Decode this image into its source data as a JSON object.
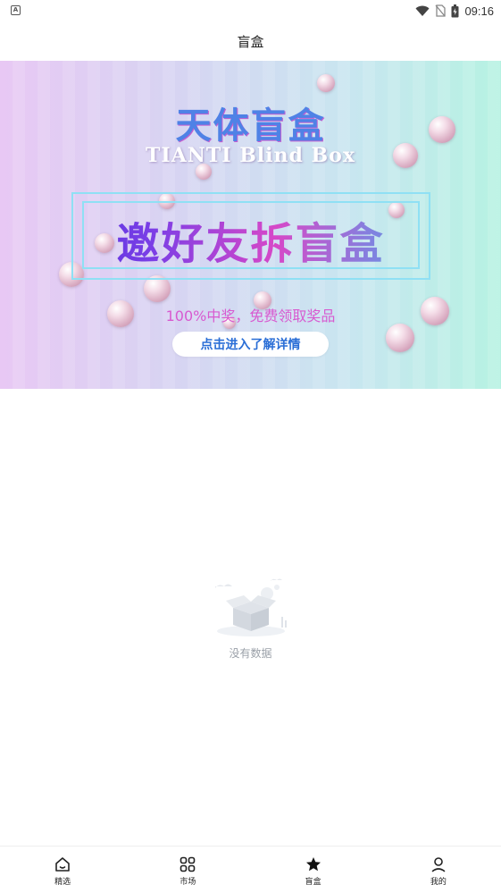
{
  "status_bar": {
    "left_icon_letter": "A",
    "time": "09:16",
    "icons": [
      "notification-icon",
      "wifi-icon",
      "no-sim-icon",
      "battery-icon"
    ]
  },
  "header": {
    "title": "盲盒"
  },
  "banner": {
    "brand_title": "天体盲盒",
    "brand_subtitle": "TIANTI Blind Box",
    "headline": "邀好友拆盲盒",
    "tagline": "100%中奖，免费领取奖品",
    "cta_label": "点击进入了解详情"
  },
  "empty_state": {
    "message": "没有数据",
    "icon": "empty-box-illustration"
  },
  "tab_bar": {
    "active_color": "#111111",
    "items": [
      {
        "label": "精选",
        "icon": "home-icon"
      },
      {
        "label": "市场",
        "icon": "grid-icon"
      },
      {
        "label": "盲盒",
        "icon": "star-icon"
      },
      {
        "label": "我的",
        "icon": "user-icon"
      }
    ]
  }
}
